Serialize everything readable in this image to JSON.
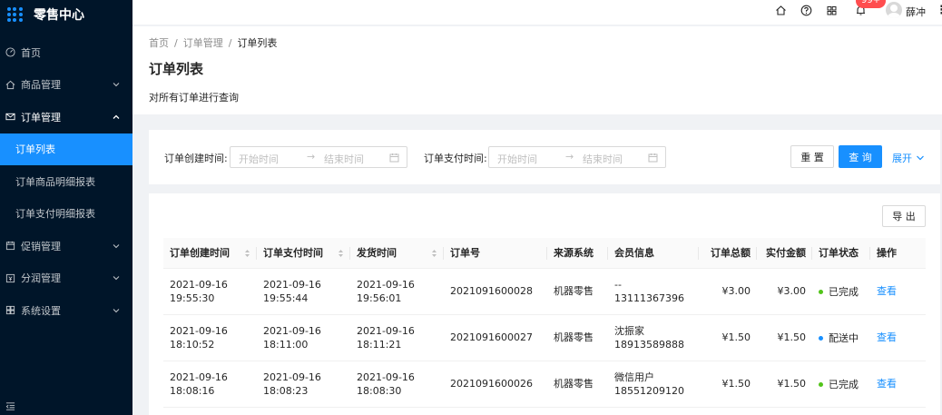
{
  "app": {
    "title": "零售中心"
  },
  "sidebar": {
    "items": [
      {
        "label": "首页",
        "icon": "dashboard-icon"
      },
      {
        "label": "商品管理",
        "icon": "home-icon"
      },
      {
        "label": "订单管理",
        "icon": "mail-icon"
      },
      {
        "label": "促销管理",
        "icon": "calendar-icon"
      },
      {
        "label": "分润管理",
        "icon": "profit-icon"
      },
      {
        "label": "系统设置",
        "icon": "settings-grid-icon"
      }
    ],
    "sub_items": [
      "订单列表",
      "订单商品明细报表",
      "订单支付明细报表"
    ]
  },
  "topbar": {
    "badge": "99+",
    "username": "薛冲",
    "more": "⋮"
  },
  "breadcrumb": [
    "首页",
    "订单管理",
    "订单列表"
  ],
  "page": {
    "title": "订单列表",
    "description": "对所有订单进行查询"
  },
  "filter": {
    "create_label": "订单创建时间:",
    "pay_label": "订单支付时间:",
    "start_placeholder": "开始时间",
    "end_placeholder": "结束时间",
    "arrow": "→",
    "reset": "重 置",
    "search": "查 询",
    "expand": "展开"
  },
  "toolbar": {
    "export": "导 出"
  },
  "table": {
    "columns": [
      "订单创建时间",
      "订单支付时间",
      "发货时间",
      "订单号",
      "来源系统",
      "会员信息",
      "订单总额",
      "实付金额",
      "订单状态",
      "操作"
    ],
    "rows": [
      {
        "created": [
          "2021-09-16",
          "19:55:30"
        ],
        "paid": [
          "2021-09-16",
          "19:55:44"
        ],
        "shipped": [
          "2021-09-16",
          "19:56:01"
        ],
        "order_no": "2021091600028",
        "source": "机器零售",
        "member": [
          "--",
          "13111367396"
        ],
        "total": "¥3.00",
        "paid_amount": "¥3.00",
        "status": "已完成",
        "action": "查看"
      },
      {
        "created": [
          "2021-09-16",
          "18:10:52"
        ],
        "paid": [
          "2021-09-16",
          "18:11:00"
        ],
        "shipped": [
          "2021-09-16",
          "18:11:21"
        ],
        "order_no": "2021091600027",
        "source": "机器零售",
        "member": [
          "沈振家",
          "18913589888"
        ],
        "total": "¥1.50",
        "paid_amount": "¥1.50",
        "status": "配送中",
        "action": "查看"
      },
      {
        "created": [
          "2021-09-16",
          "18:08:16"
        ],
        "paid": [
          "2021-09-16",
          "18:08:23"
        ],
        "shipped": [
          "2021-09-16",
          "18:08:30"
        ],
        "order_no": "2021091600026",
        "source": "机器零售",
        "member": [
          "微信用户",
          "18551209120"
        ],
        "total": "¥1.50",
        "paid_amount": "¥1.50",
        "status": "已完成",
        "action": "查看"
      }
    ]
  },
  "colors": {
    "primary": "#1890ff",
    "sidebar_bg": "#001529",
    "done": "#52c41a",
    "delivering": "#1890ff",
    "badge": "#ff4d4f"
  }
}
